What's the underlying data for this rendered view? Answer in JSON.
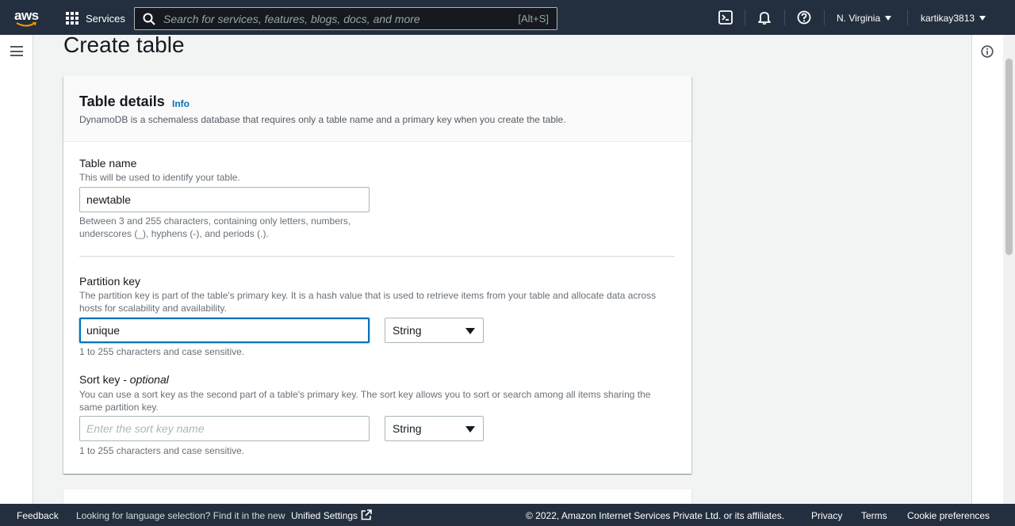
{
  "topnav": {
    "logo_text": "aws",
    "services_label": "Services",
    "search_placeholder": "Search for services, features, blogs, docs, and more",
    "search_shortcut": "[Alt+S]",
    "region_label": "N. Virginia",
    "account_label": "kartikay3813"
  },
  "page": {
    "title": "Create table"
  },
  "table_details": {
    "title": "Table details",
    "info_label": "Info",
    "description": "DynamoDB is a schemaless database that requires only a table name and a primary key when you create the table.",
    "table_name": {
      "label": "Table name",
      "description": "This will be used to identify your table.",
      "value": "newtable",
      "constraint_line1": "Between 3 and 255 characters, containing only letters, numbers,",
      "constraint_line2": "underscores (_), hyphens (-), and periods (.)."
    },
    "partition_key": {
      "label": "Partition key",
      "description_line1": "The partition key is part of the table's primary key. It is a hash value that is used to retrieve items from your table and allocate data across",
      "description_line2": "hosts for scalability and availability.",
      "value": "unique",
      "type": "String",
      "constraint": "1 to 255 characters and case sensitive."
    },
    "sort_key": {
      "label": "Sort key - ",
      "label_optional": "optional",
      "description_line1": "You can use a sort key as the second part of a table's primary key. The sort key allows you to sort or search among all items sharing the",
      "description_line2": "same partition key.",
      "placeholder": "Enter the sort key name",
      "type": "String",
      "constraint": "1 to 255 characters and case sensitive."
    }
  },
  "footer": {
    "feedback": "Feedback",
    "language_prompt": "Looking for language selection? Find it in the new",
    "unified_settings": "Unified Settings",
    "copyright": "© 2022, Amazon Internet Services Private Ltd. or its affiliates.",
    "privacy": "Privacy",
    "terms": "Terms",
    "cookie_preferences": "Cookie preferences"
  },
  "colors": {
    "nav_bg": "#232f3e",
    "link": "#0073bb",
    "smile": "#ff9900"
  }
}
